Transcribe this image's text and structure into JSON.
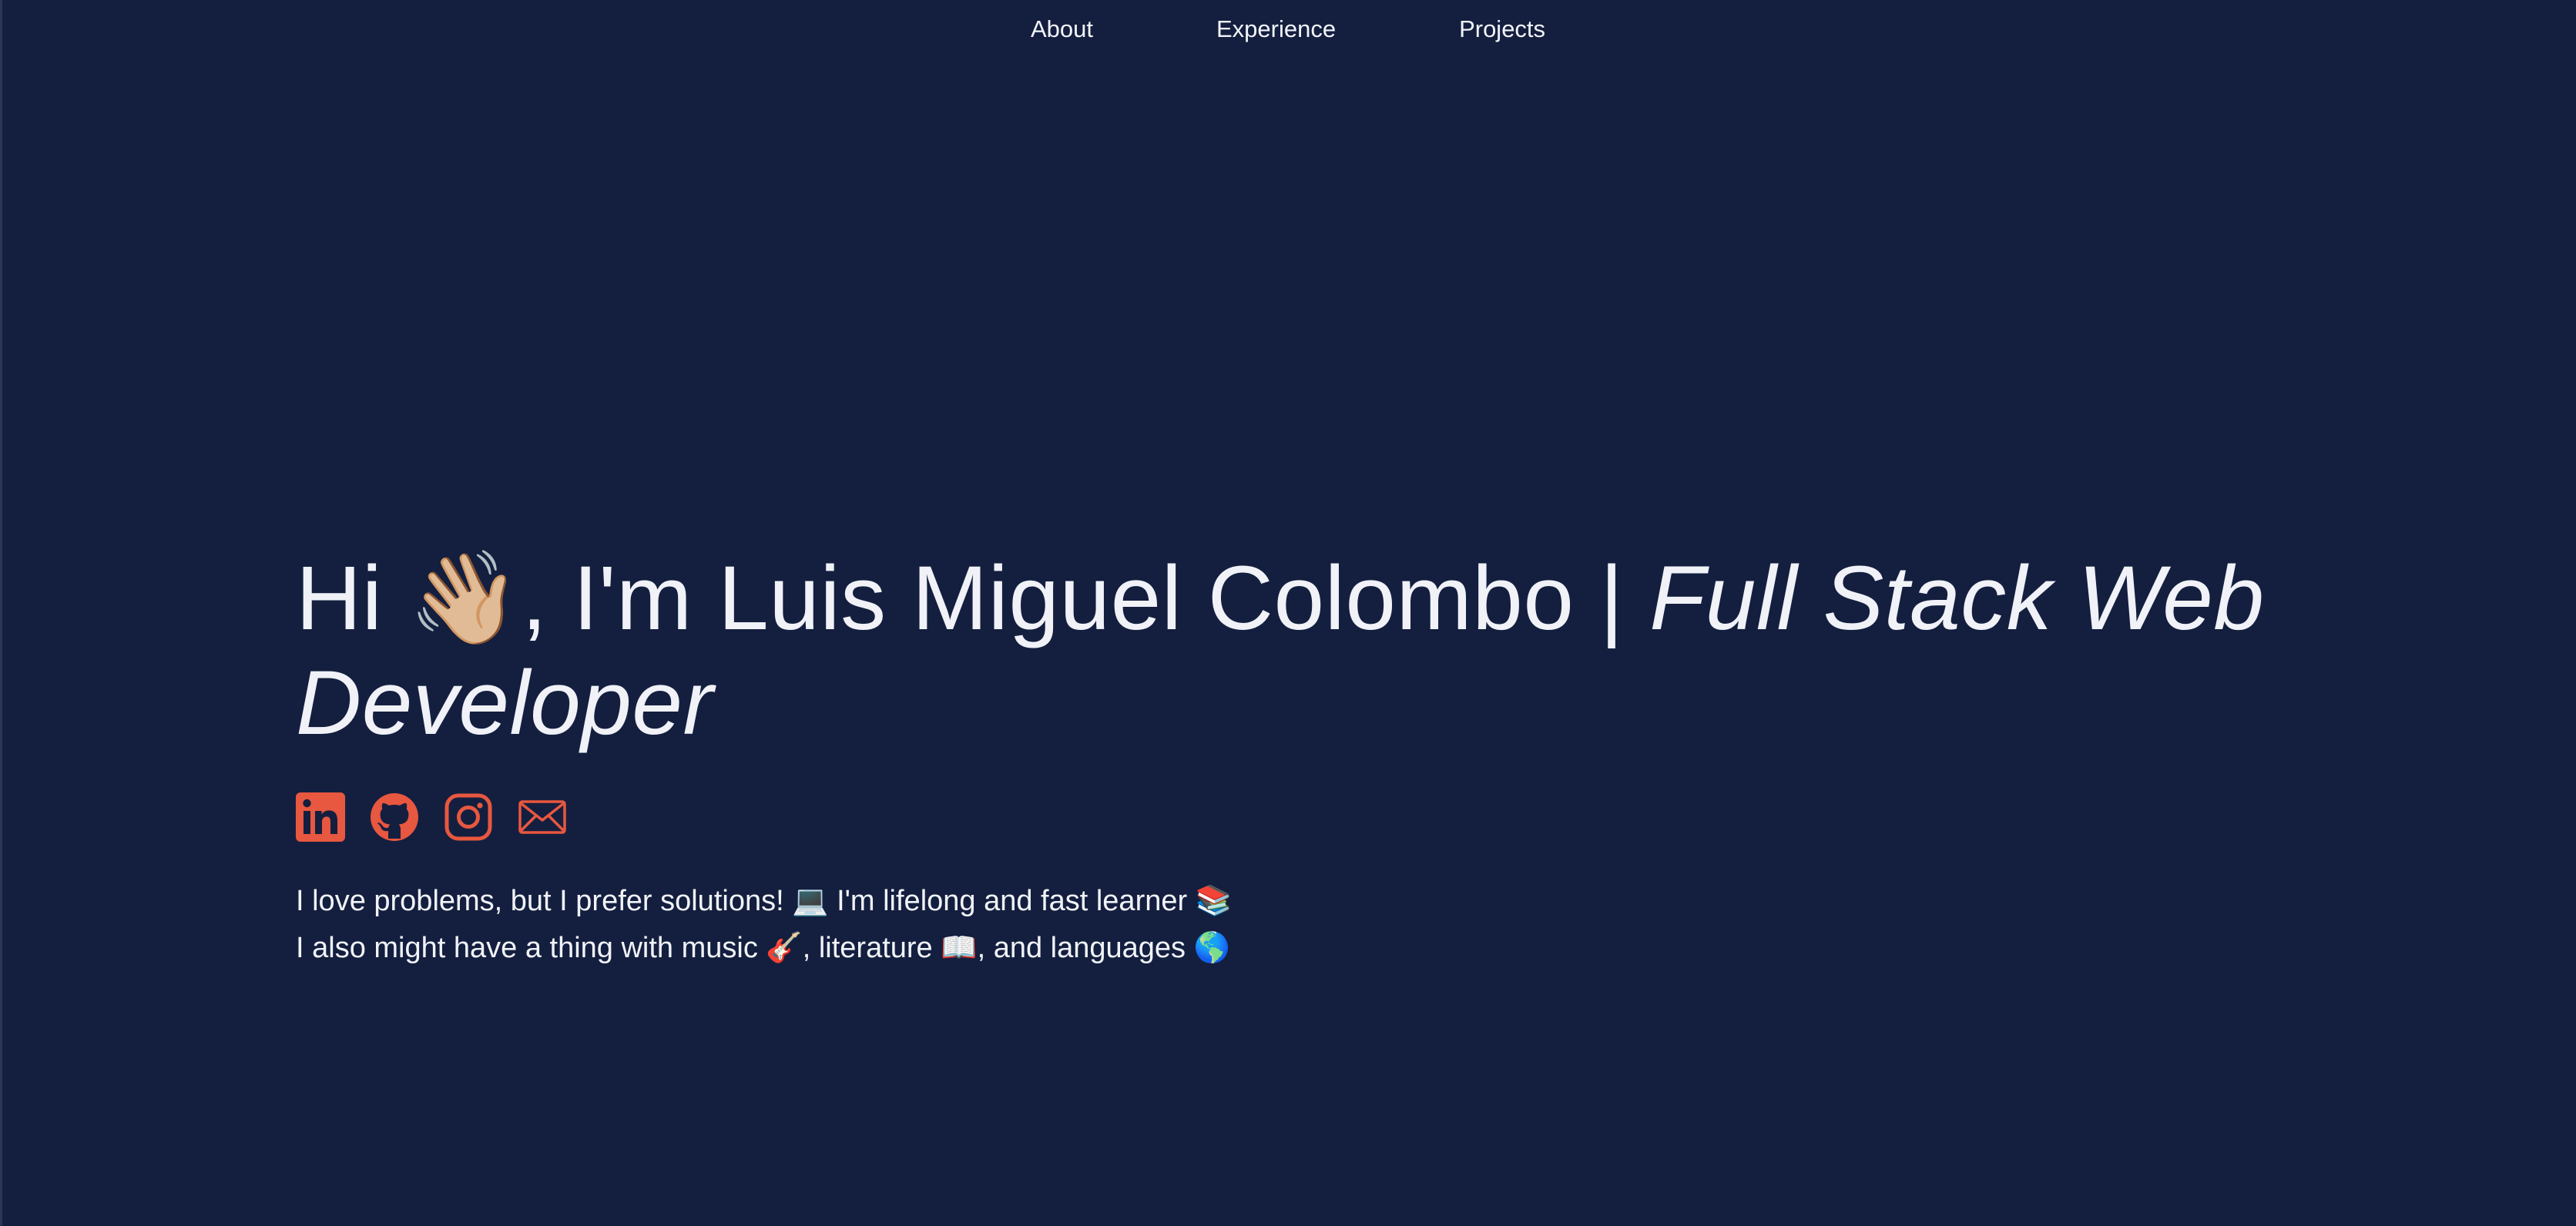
{
  "nav": {
    "items": [
      {
        "label": "About"
      },
      {
        "label": "Experience"
      },
      {
        "label": "Projects"
      }
    ]
  },
  "hero": {
    "greeting_pre": "Hi ",
    "wave_emoji": "👋🏼",
    "greeting_post": ", I'm Luis Miguel Colombo | ",
    "role": "Full Stack Web Developer"
  },
  "socials": [
    {
      "icon": "linkedin-icon"
    },
    {
      "icon": "github-icon"
    },
    {
      "icon": "instagram-icon"
    },
    {
      "icon": "mail-icon"
    }
  ],
  "bio": {
    "line1_text": "I love problems, but I prefer solutions! ",
    "line1_emoji1": "💻",
    "line1_text2": " I'm lifelong and fast learner ",
    "line1_emoji2": "📚",
    "line2_text": "I also might have a thing with music ",
    "line2_emoji1": "🎸",
    "line2_text2": ", literature ",
    "line2_emoji2": "📖",
    "line2_text3": ", and languages ",
    "line2_emoji3": "🌎"
  },
  "colors": {
    "background": "#141f3f",
    "accent": "#e8573f",
    "text": "#f0f2f8"
  }
}
